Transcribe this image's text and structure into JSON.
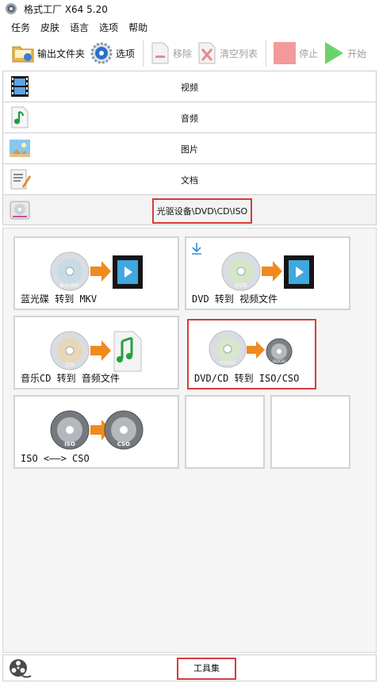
{
  "window": {
    "title": "格式工厂 X64 5.20"
  },
  "menu": [
    "任务",
    "皮肤",
    "语言",
    "选项",
    "帮助"
  ],
  "toolbar": {
    "output_folder": "输出文件夹",
    "options": "选项",
    "remove": "移除",
    "clear_list": "清空列表",
    "stop": "停止",
    "start": "开始"
  },
  "categories": [
    {
      "label": "视频",
      "icon": "film-icon"
    },
    {
      "label": "音频",
      "icon": "music-note-icon"
    },
    {
      "label": "图片",
      "icon": "picture-icon"
    },
    {
      "label": "文档",
      "icon": "document-icon"
    },
    {
      "label": "光驱设备\\DVD\\CD\\ISO",
      "icon": "disc-drive-icon"
    }
  ],
  "tools": [
    {
      "label": "蓝光碟 转到 MKV",
      "disc_text": "BLU-RAY"
    },
    {
      "label": "DVD 转到 视频文件",
      "disc_text": "DVD"
    },
    {
      "label": "音乐CD 转到 音频文件",
      "disc_text": "CD"
    },
    {
      "label": "DVD/CD 转到 ISO/CSO",
      "disc_text": "DVD/CD",
      "disc_text2": "ISO/CSO"
    },
    {
      "label": "ISO <——> CSO",
      "disc_text": "ISO",
      "disc_text2": "CSO"
    }
  ],
  "bottom": {
    "label": "工具集",
    "icon": "film-reel-icon"
  },
  "colors": {
    "highlight": "#d93a3a",
    "arrow": "#f08a1c",
    "start_green": "#6cd36c",
    "stop_red": "#f29a9a"
  }
}
